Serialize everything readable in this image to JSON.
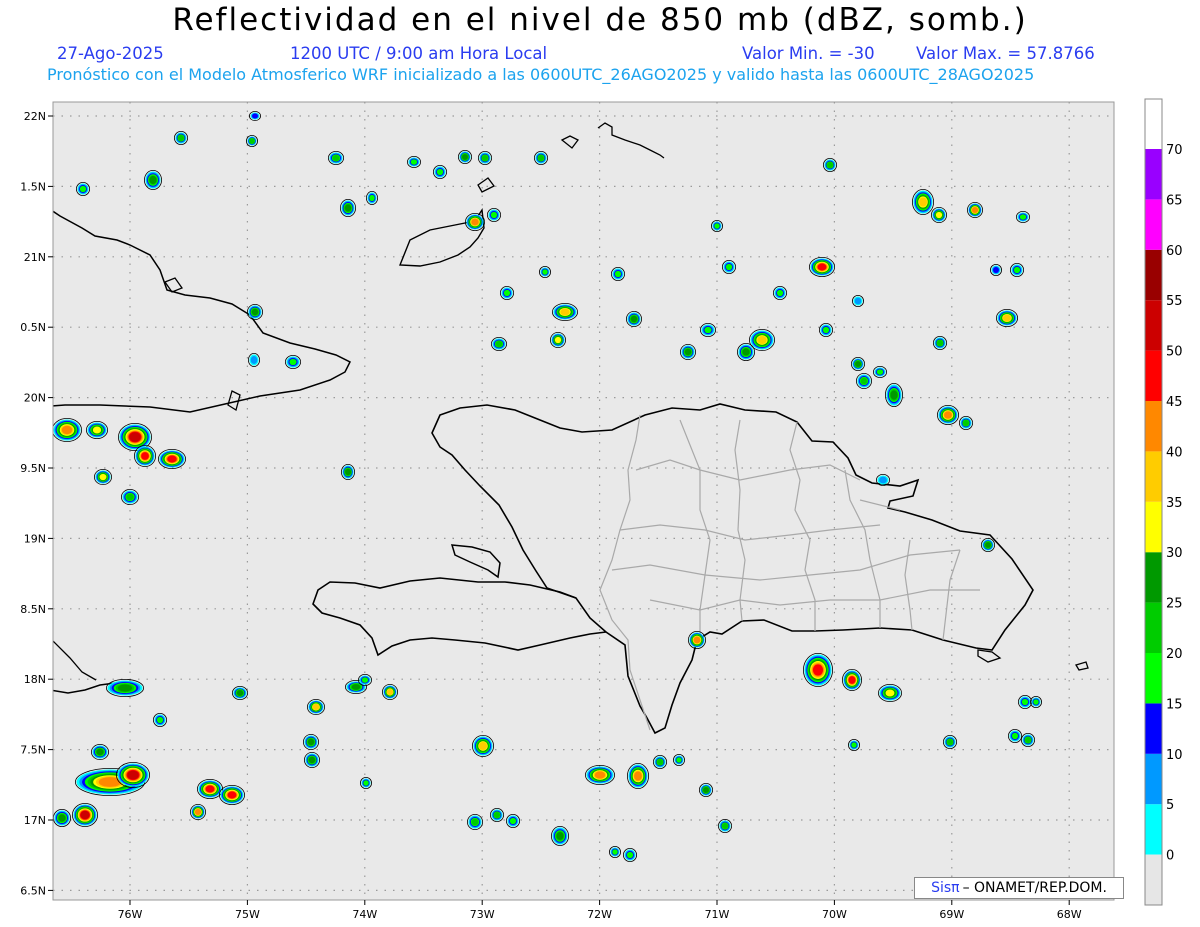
{
  "header": {
    "title": "Reflectividad en el nivel de 850 mb (dBZ, somb.)",
    "date": "27-Ago-2025",
    "time": "1200 UTC / 9:00 am Hora Local",
    "value_min": "Valor Min. = -30",
    "value_max": "Valor Max. = 57.8766",
    "model_info": "Pronóstico con el Modelo Atmosferico WRF inicializado a las 0600UTC_26AGO2025 y valido hasta las  0600UTC_28AGO2025"
  },
  "map": {
    "region": "Hispaniola",
    "lon_range": [
      -76.65,
      -67.6
    ],
    "lat_range": [
      16.45,
      22.1
    ],
    "lat_labels": [
      "22N",
      "1.5N",
      "21N",
      "0.5N",
      "20N",
      "9.5N",
      "19N",
      "8.5N",
      "18N",
      "7.5N",
      "17N",
      "6.5N"
    ],
    "lat_values": [
      22.0,
      21.5,
      21.0,
      20.5,
      20.0,
      19.5,
      19.0,
      18.5,
      18.0,
      17.5,
      17.0,
      16.5
    ],
    "lon_labels": [
      "76W",
      "75W",
      "74W",
      "73W",
      "72W",
      "71W",
      "70W",
      "69W",
      "68W"
    ],
    "lon_values": [
      -76,
      -75,
      -74,
      -73,
      -72,
      -71,
      -70,
      -69,
      -68
    ],
    "grid": true
  },
  "legend": {
    "values": [
      "0",
      "5",
      "10",
      "15",
      "20",
      "25",
      "30",
      "35",
      "40",
      "45",
      "50",
      "55",
      "60",
      "65",
      "70"
    ],
    "colors": [
      "#00ffff",
      "#0099ff",
      "#0000ff",
      "#00ff00",
      "#00cc00",
      "#009900",
      "#ffff00",
      "#ffcc00",
      "#ff8800",
      "#ff0000",
      "#cc0000",
      "#990000",
      "#ff00ff",
      "#9900ff"
    ],
    "below_color": "#e6e6e6",
    "above_color": "#ffffff"
  },
  "credit": {
    "sis": "Sisπ",
    "org": "– ONAMET/REP.DOM."
  }
}
